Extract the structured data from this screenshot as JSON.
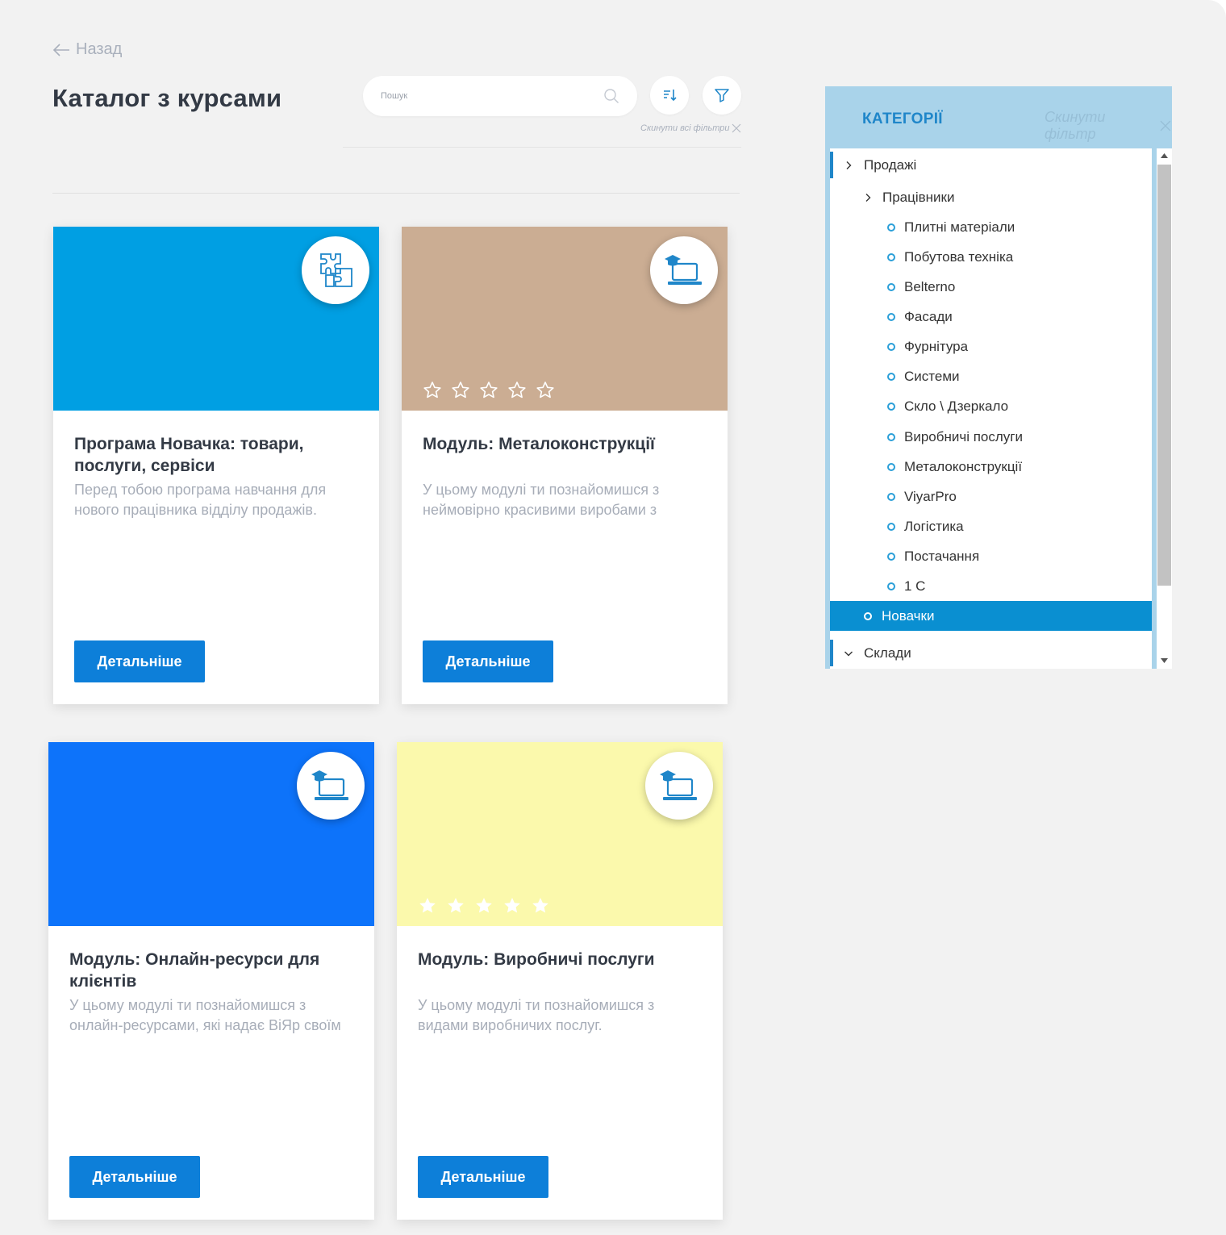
{
  "header": {
    "back_label": "Назад",
    "title": "Каталог з курсами",
    "search_placeholder": "Пошук",
    "reset_all_label": "Скинути всі фільтри"
  },
  "colors": {
    "accent": "#0d7fd9",
    "panel_header": "#a9d3ea",
    "selected": "#0a8fd1"
  },
  "cards": [
    {
      "title": "Програма Новачка: товари, послуги, сервіси",
      "description": "Перед тобою програма навчання для нового працівника відділу продажів.",
      "button": "Детальніше",
      "banner_color": "#009fe3",
      "icon": "puzzle-icon",
      "rating": null
    },
    {
      "title": "Модуль: Металоконструкції",
      "description": "У цьому модулі ти познайомишся з неймовірно красивими виробами з",
      "button": "Детальніше",
      "banner_color": "#cbad93",
      "icon": "laptop-graduation-icon",
      "rating": 0
    },
    {
      "title": "Модуль: Онлайн-ресурси для клієнтів",
      "description": "У цьому модулі ти познайомишся з онлайн-ресурсами, які надає ВіЯр своїм",
      "button": "Детальніше",
      "banner_color": "#0d73fa",
      "icon": "laptop-graduation-icon",
      "rating": null
    },
    {
      "title": "Модуль: Виробничі послуги",
      "description": "У цьому модулі ти познайомишся з видами виробничих послуг.",
      "button": "Детальніше",
      "banner_color": "#fbf9ac",
      "icon": "laptop-graduation-icon",
      "rating": 5
    }
  ],
  "categories": {
    "title": "КАТЕГОРІЇ",
    "reset_label": "Скинути фільтр",
    "items": [
      {
        "label": "Продажі",
        "type": "collapsed",
        "level": 0
      },
      {
        "label": "Працівники",
        "type": "collapsed",
        "level": 1
      },
      {
        "label": "Плитні матеріали",
        "type": "leaf",
        "level": 2
      },
      {
        "label": "Побутова техніка",
        "type": "leaf",
        "level": 2
      },
      {
        "label": "Belterno",
        "type": "leaf",
        "level": 2
      },
      {
        "label": "Фасади",
        "type": "leaf",
        "level": 2
      },
      {
        "label": "Фурнітура",
        "type": "leaf",
        "level": 2
      },
      {
        "label": "Системи",
        "type": "leaf",
        "level": 2
      },
      {
        "label": "Скло \\ Дзеркало",
        "type": "leaf",
        "level": 2
      },
      {
        "label": "Виробничі послуги",
        "type": "leaf",
        "level": 2
      },
      {
        "label": "Металоконструкції",
        "type": "leaf",
        "level": 2
      },
      {
        "label": "ViyarPro",
        "type": "leaf",
        "level": 2
      },
      {
        "label": "Логістика",
        "type": "leaf",
        "level": 2
      },
      {
        "label": "Постачання",
        "type": "leaf",
        "level": 2
      },
      {
        "label": "1 C",
        "type": "leaf",
        "level": 2
      },
      {
        "label": "Новачки",
        "type": "leaf",
        "level": 1,
        "selected": true
      },
      {
        "label": "Склади",
        "type": "expanded",
        "level": 0
      }
    ]
  }
}
